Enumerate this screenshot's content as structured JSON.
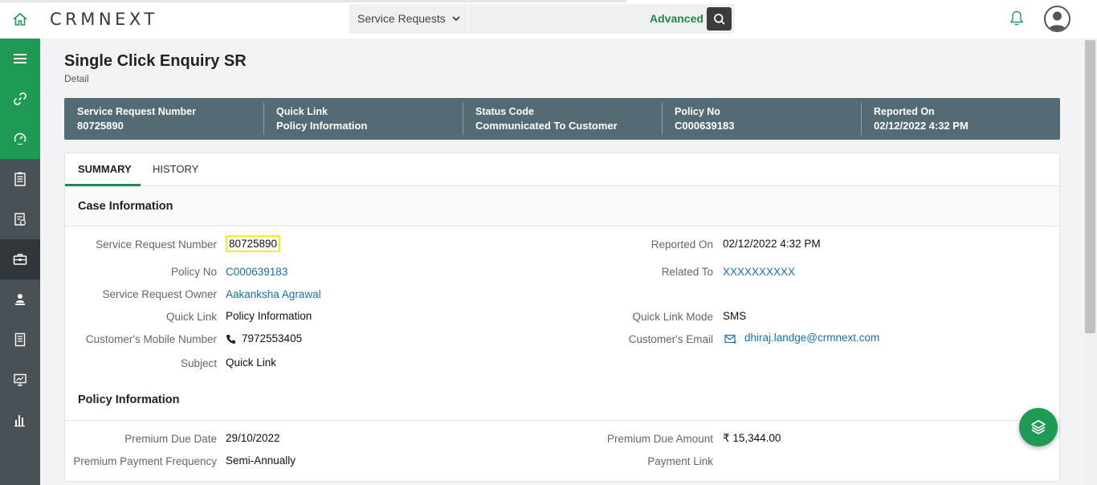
{
  "header": {
    "logo": "CRMNEXT",
    "search": {
      "module": "Service Requests",
      "placeholder": "",
      "advanced_label": "Advanced"
    }
  },
  "page": {
    "title": "Single Click Enquiry SR",
    "subtitle": "Detail"
  },
  "infobar": [
    {
      "label": "Service Request Number",
      "value": "80725890"
    },
    {
      "label": "Quick Link",
      "value": "Policy Information"
    },
    {
      "label": "Status Code",
      "value": "Communicated To Customer"
    },
    {
      "label": "Policy No",
      "value": "C000639183"
    },
    {
      "label": "Reported On",
      "value": "02/12/2022 4:32 PM"
    }
  ],
  "tabs": [
    {
      "label": "SUMMARY",
      "active": true
    },
    {
      "label": "HISTORY",
      "active": false
    }
  ],
  "case_information": {
    "title": "Case Information",
    "left": [
      {
        "label": "Service Request Number",
        "value": "80725890"
      },
      {
        "label": "Policy No",
        "value": "C000639183"
      },
      {
        "label": "Service Request Owner",
        "value": "Aakanksha Agrawal"
      },
      {
        "label": "Quick Link",
        "value": "Policy Information"
      },
      {
        "label": "Customer's Mobile Number",
        "value": "7972553405"
      },
      {
        "label": "Subject",
        "value": "Quick Link"
      }
    ],
    "right": [
      {
        "label": "Reported On",
        "value": "02/12/2022 4:32 PM"
      },
      {
        "label": "Related To",
        "value": "XXXXXXXXXX"
      },
      {
        "label": "Quick Link Mode",
        "value": "SMS"
      },
      {
        "label": "Customer's Email",
        "value": "dhiraj.landge@crmnext.com"
      }
    ]
  },
  "policy_information": {
    "title": "Policy Information",
    "left": [
      {
        "label": "Premium Due Date",
        "value": "29/10/2022"
      },
      {
        "label": "Premium Payment Frequency",
        "value": "Semi-Annually"
      }
    ],
    "right": [
      {
        "label": "Premium Due Amount",
        "value": "₹ 15,344.00"
      },
      {
        "label": "Payment Link",
        "value": ""
      }
    ]
  },
  "colors": {
    "brand_green": "#1e9a55",
    "infobar": "#546a75",
    "sidebar": "#4a5156",
    "link": "#1a6fb0",
    "highlight": "#f5ec1b"
  },
  "icons": {
    "topbar": [
      "home-icon",
      "chevron-down-icon",
      "search-icon",
      "bell-icon",
      "user-avatar-icon"
    ],
    "sidebar": [
      "menu-icon",
      "link-icon",
      "dashboard-icon",
      "list-icon",
      "report-icon",
      "briefcase-icon",
      "agent-icon",
      "document-icon",
      "presentation-icon",
      "bar-chart-icon"
    ],
    "fields": [
      "phone-icon",
      "email-icon"
    ],
    "fab": "layers-icon"
  }
}
